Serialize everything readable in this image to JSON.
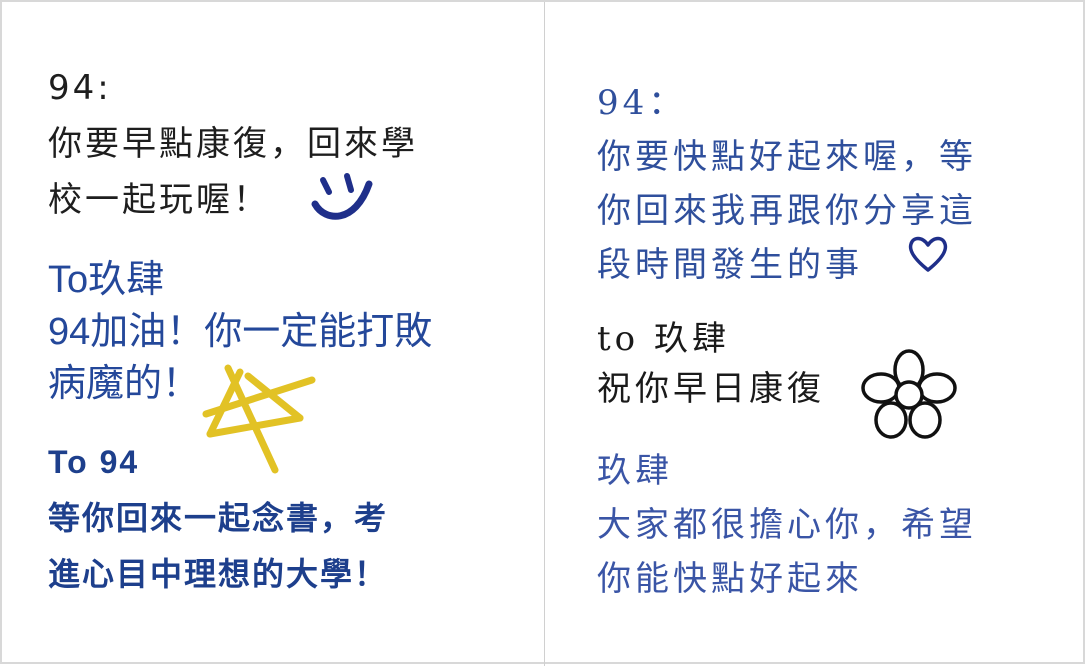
{
  "notes": {
    "n1": [
      "94:",
      "你要早點康復，回來學",
      "校一起玩喔！"
    ],
    "n2": [
      "To玖肆",
      "94加油！你一定能打敗",
      "病魔的！"
    ],
    "n3": [
      "To 94",
      "等你回來一起念書，考",
      "進心目中理想的大學！"
    ],
    "n4": [
      "94：",
      "你要快點好起來喔，等",
      "你回來我再跟你分享這",
      "段時間發生的事"
    ],
    "n5": [
      "to 玖肆",
      "祝你早日康復"
    ],
    "n6": [
      "玖肆",
      "大家都很擔心你，希望",
      "你能快點好起來"
    ]
  },
  "decorations": {
    "smiley": "smiley-doodle",
    "star": "star-doodle",
    "heart": "heart-outline-icon",
    "flower": "flower-outline-icon"
  },
  "colors": {
    "black_ink": "#1e1e1e",
    "blue_ink": "#24489a",
    "navy_bold": "#1d3f8c",
    "blue_serif": "#2f4f9c",
    "yellow_doodle": "#e2c225",
    "navy_doodle": "#1f2f8a"
  }
}
